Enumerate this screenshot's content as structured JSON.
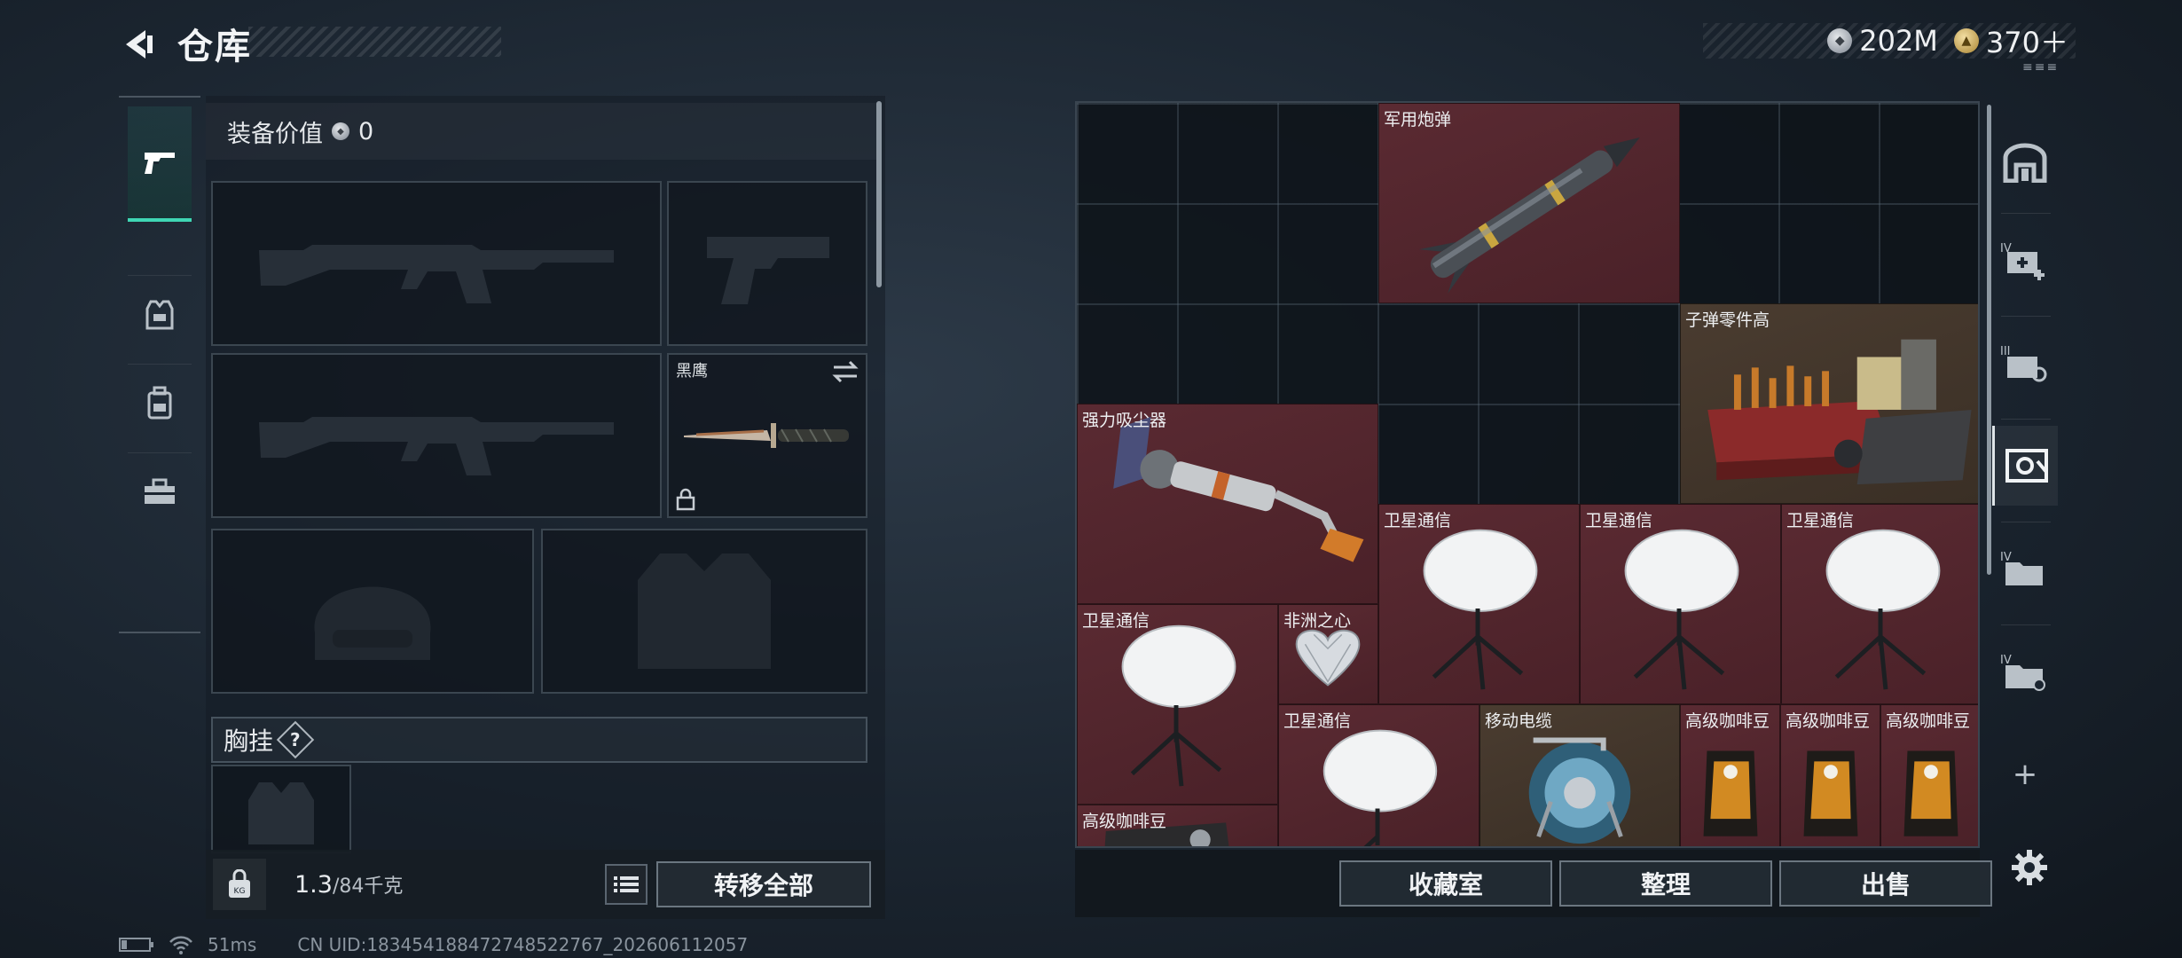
{
  "header": {
    "title": "仓库",
    "currencies": [
      {
        "icon": "silver-coin-icon",
        "value": "202M"
      },
      {
        "icon": "gold-coin-icon",
        "value": "370＋"
      }
    ],
    "sub_tag": "≡≡≡"
  },
  "left_nav": {
    "items": [
      {
        "name": "weapons",
        "icon": "pistol-icon",
        "active": true
      },
      {
        "name": "armor",
        "icon": "armor-vest-icon",
        "active": false
      },
      {
        "name": "backpack",
        "icon": "backpack-icon",
        "active": false
      },
      {
        "name": "toolbox",
        "icon": "toolbox-icon",
        "active": false
      }
    ]
  },
  "loadout": {
    "equip_value_label": "装备价值",
    "equip_value": "0",
    "melee_name": "黑鹰",
    "chest_rig_label": "胸挂",
    "help_mark": "?",
    "weight_value": "1.3",
    "weight_max": "/84千克",
    "transfer_all": "转移全部"
  },
  "storage": {
    "items": [
      {
        "name": "军用炮弹",
        "color": "#5a2a32"
      },
      {
        "name": "子弹零件高",
        "color": "#4a3c30"
      },
      {
        "name": "强力吸尘器",
        "color": "#5a2a32"
      },
      {
        "name": "卫星通信",
        "color": "#5a2a32"
      },
      {
        "name": "卫星通信",
        "color": "#5a2a32"
      },
      {
        "name": "卫星通信",
        "color": "#5a2a32"
      },
      {
        "name": "卫星通信",
        "color": "#5a2a32"
      },
      {
        "name": "非洲之心",
        "color": "#5a2a32"
      },
      {
        "name": "卫星通信",
        "color": "#5a2a32"
      },
      {
        "name": "移动电缆",
        "color": "#4a3c30"
      },
      {
        "name": "高级咖啡豆",
        "color": "#5a2a32"
      },
      {
        "name": "高级咖啡豆",
        "color": "#5a2a32"
      },
      {
        "name": "高级咖啡豆",
        "color": "#5a2a32"
      },
      {
        "name": "高级咖啡豆",
        "color": "#5a2a32"
      }
    ],
    "buttons": {
      "collection": "收藏室",
      "organize": "整理",
      "sell": "出售"
    }
  },
  "right_tabs": {
    "plus": "+"
  },
  "status": {
    "ping": "51ms",
    "uid": "CN UID:1834541884727485227​67_202606112057"
  }
}
